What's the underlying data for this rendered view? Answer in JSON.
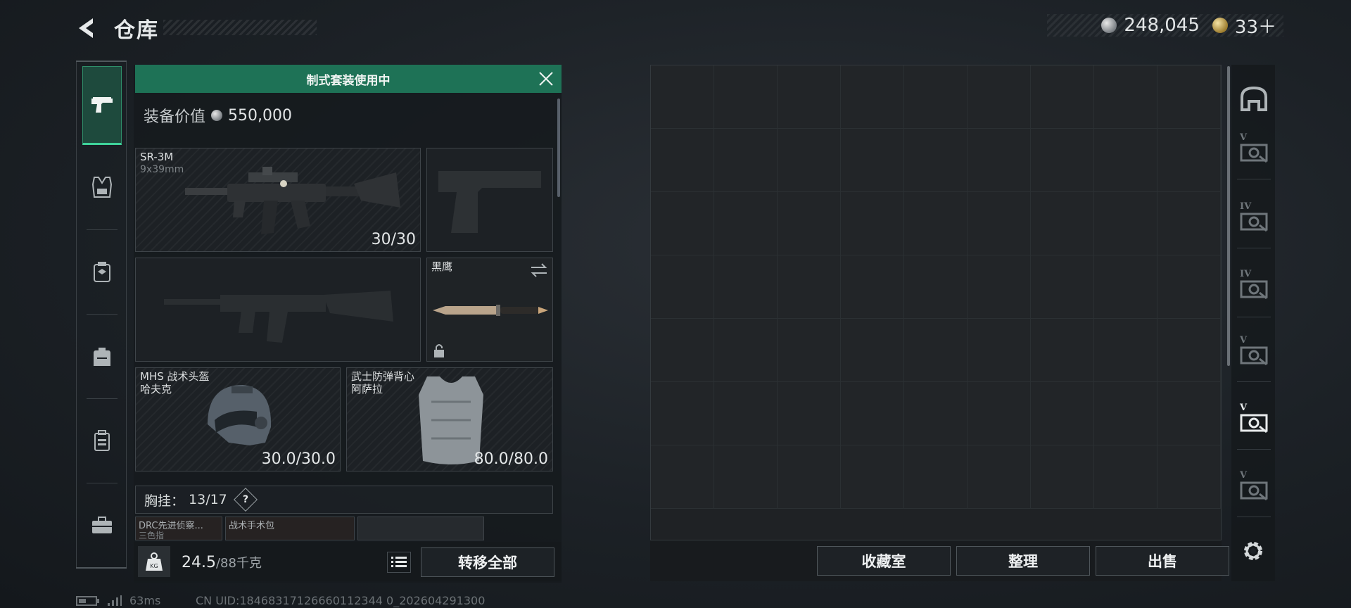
{
  "header": {
    "title": "仓库",
    "back_icon": "back-arrow-icon",
    "currencies": [
      {
        "icon": "silver-coin-icon",
        "value": "248,045"
      },
      {
        "icon": "gold-coin-icon",
        "value": "33＋"
      }
    ]
  },
  "sidebar": {
    "tabs": [
      {
        "name": "weapons",
        "icon": "pistol-icon",
        "active": true
      },
      {
        "name": "armor",
        "icon": "vest-icon",
        "active": false
      },
      {
        "name": "chest-rig",
        "icon": "chest-rig-icon",
        "active": false
      },
      {
        "name": "backpack",
        "icon": "backpack-icon",
        "active": false
      },
      {
        "name": "container",
        "icon": "case-icon",
        "active": false
      },
      {
        "name": "medkit",
        "icon": "toolbox-icon",
        "active": false
      }
    ]
  },
  "loadout": {
    "banner": "制式套装使用中",
    "value_label": "装备价值",
    "value": "550,000",
    "slots": {
      "primary": {
        "name": "SR-3M",
        "ammo": "9x39mm",
        "count": "30/30"
      },
      "melee": {
        "name": "黑鹰"
      },
      "helmet": {
        "name": "MHS 战术头盔",
        "sub": "哈夫克",
        "durability": "30.0/30.0"
      },
      "vest": {
        "name": "武士防弹背心",
        "sub": "阿萨拉",
        "durability": "80.0/80.0"
      }
    },
    "chest_rig_label": "胸挂：",
    "chest_rig_count": "13/17",
    "chest_help": "?",
    "mini_items": [
      {
        "t1": "DRC先进侦察...",
        "t2": "三色指"
      },
      {
        "t1": "战术手术包",
        "t2": ""
      },
      {
        "t1": "",
        "t2": ""
      }
    ],
    "weight": "24.5",
    "weight_cap": "/88千克",
    "weight_icon_label": "KG",
    "transfer_all": "转移全部"
  },
  "storage": {
    "columns": 9,
    "rows": 7,
    "buttons": {
      "collection": "收藏室",
      "organize": "整理",
      "sell": "出售"
    }
  },
  "containers": [
    {
      "icon": "stash-icon",
      "tier": ""
    },
    {
      "icon": "safe-box-icon",
      "tier": "V"
    },
    {
      "icon": "safe-box-icon",
      "tier": "IV"
    },
    {
      "icon": "safe-box-icon",
      "tier": "IV"
    },
    {
      "icon": "safe-box-icon",
      "tier": "V"
    },
    {
      "icon": "safe-box-icon",
      "tier": "V"
    },
    {
      "icon": "safe-box-icon",
      "tier": "V"
    }
  ],
  "footer": {
    "ping": "63ms",
    "uid": "CN UID:18468317126660112344 0_202604291300"
  },
  "colors": {
    "accent_green": "#1e7256",
    "tab_active": "#3fd39a"
  }
}
